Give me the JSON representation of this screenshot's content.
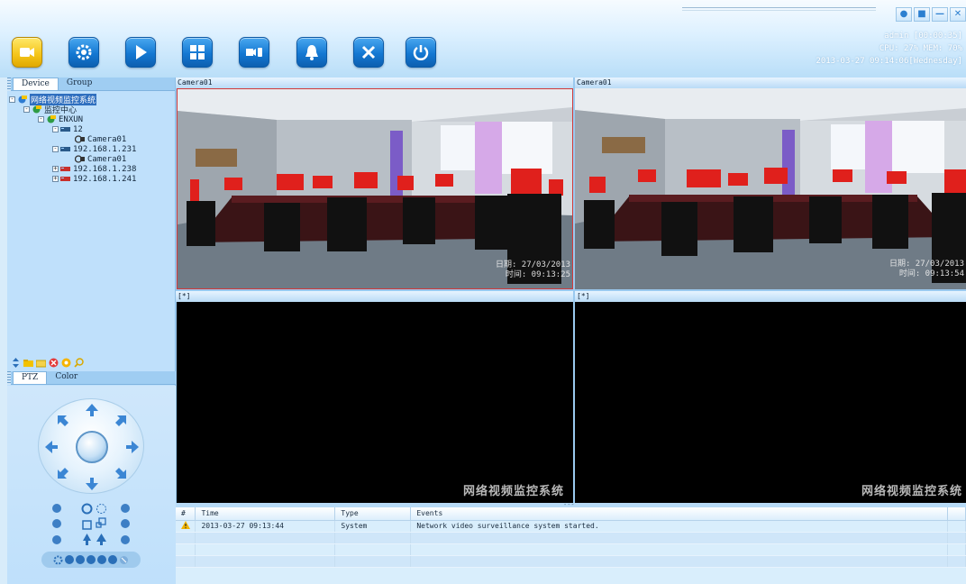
{
  "toolbar": {
    "buttons": [
      {
        "name": "camera",
        "active": true
      },
      {
        "name": "settings"
      },
      {
        "name": "playback"
      },
      {
        "name": "layout"
      },
      {
        "name": "record"
      },
      {
        "name": "alarm"
      },
      {
        "name": "tools"
      },
      {
        "name": "power"
      }
    ]
  },
  "status": {
    "user": "admin  [00:00:35]",
    "cpu": "CPU: 27% MEM: 70%",
    "datetime": "2013-03-27 09:14:06[Wednesday]"
  },
  "left_panel": {
    "tabs": [
      "Device",
      "Group"
    ],
    "tree": [
      {
        "level": 0,
        "label": "网络视频监控系统",
        "toggle": "-",
        "icon": "system",
        "selected": true
      },
      {
        "level": 1,
        "label": "监控中心",
        "toggle": "-",
        "icon": "center"
      },
      {
        "level": 2,
        "label": "ENXUN",
        "toggle": "-",
        "icon": "center"
      },
      {
        "level": 3,
        "label": "12",
        "toggle": "-",
        "icon": "dvr"
      },
      {
        "level": 4,
        "label": "Camera01",
        "toggle": "",
        "icon": "camera"
      },
      {
        "level": 3,
        "label": "192.168.1.231",
        "toggle": "-",
        "icon": "dvr"
      },
      {
        "level": 4,
        "label": "Camera01",
        "toggle": "",
        "icon": "camera"
      },
      {
        "level": 3,
        "label": "192.168.1.238",
        "toggle": "+",
        "icon": "dvr-red"
      },
      {
        "level": 3,
        "label": "192.168.1.241",
        "toggle": "+",
        "icon": "dvr-red"
      }
    ],
    "ptz_tabs": [
      "PTZ",
      "Color"
    ]
  },
  "video": {
    "panes": [
      {
        "title": "Camera01",
        "live": true,
        "selected": true,
        "osd_date": "日期: 27/03/2013",
        "osd_time": "时间: 09:13:25"
      },
      {
        "title": "Camera01",
        "live": true,
        "selected": false,
        "osd_date": "日期: 27/03/2013",
        "osd_time": "时间: 09:13:54"
      },
      {
        "title": "[*]",
        "live": false,
        "watermark": "网络视频监控系统"
      },
      {
        "title": "[*]",
        "live": false,
        "watermark": "网络视频监控系统"
      }
    ],
    "divider": "---"
  },
  "events": {
    "columns": [
      "#",
      "Time",
      "Type",
      "Events"
    ],
    "rows": [
      {
        "num": "",
        "time": "2013-03-27 09:13:44",
        "type": "System",
        "event": "Network video surveillance system started."
      }
    ]
  },
  "colors": {
    "accent": "#1478d2",
    "active_button": "#f4c418",
    "selection_border": "#d23a3a"
  }
}
